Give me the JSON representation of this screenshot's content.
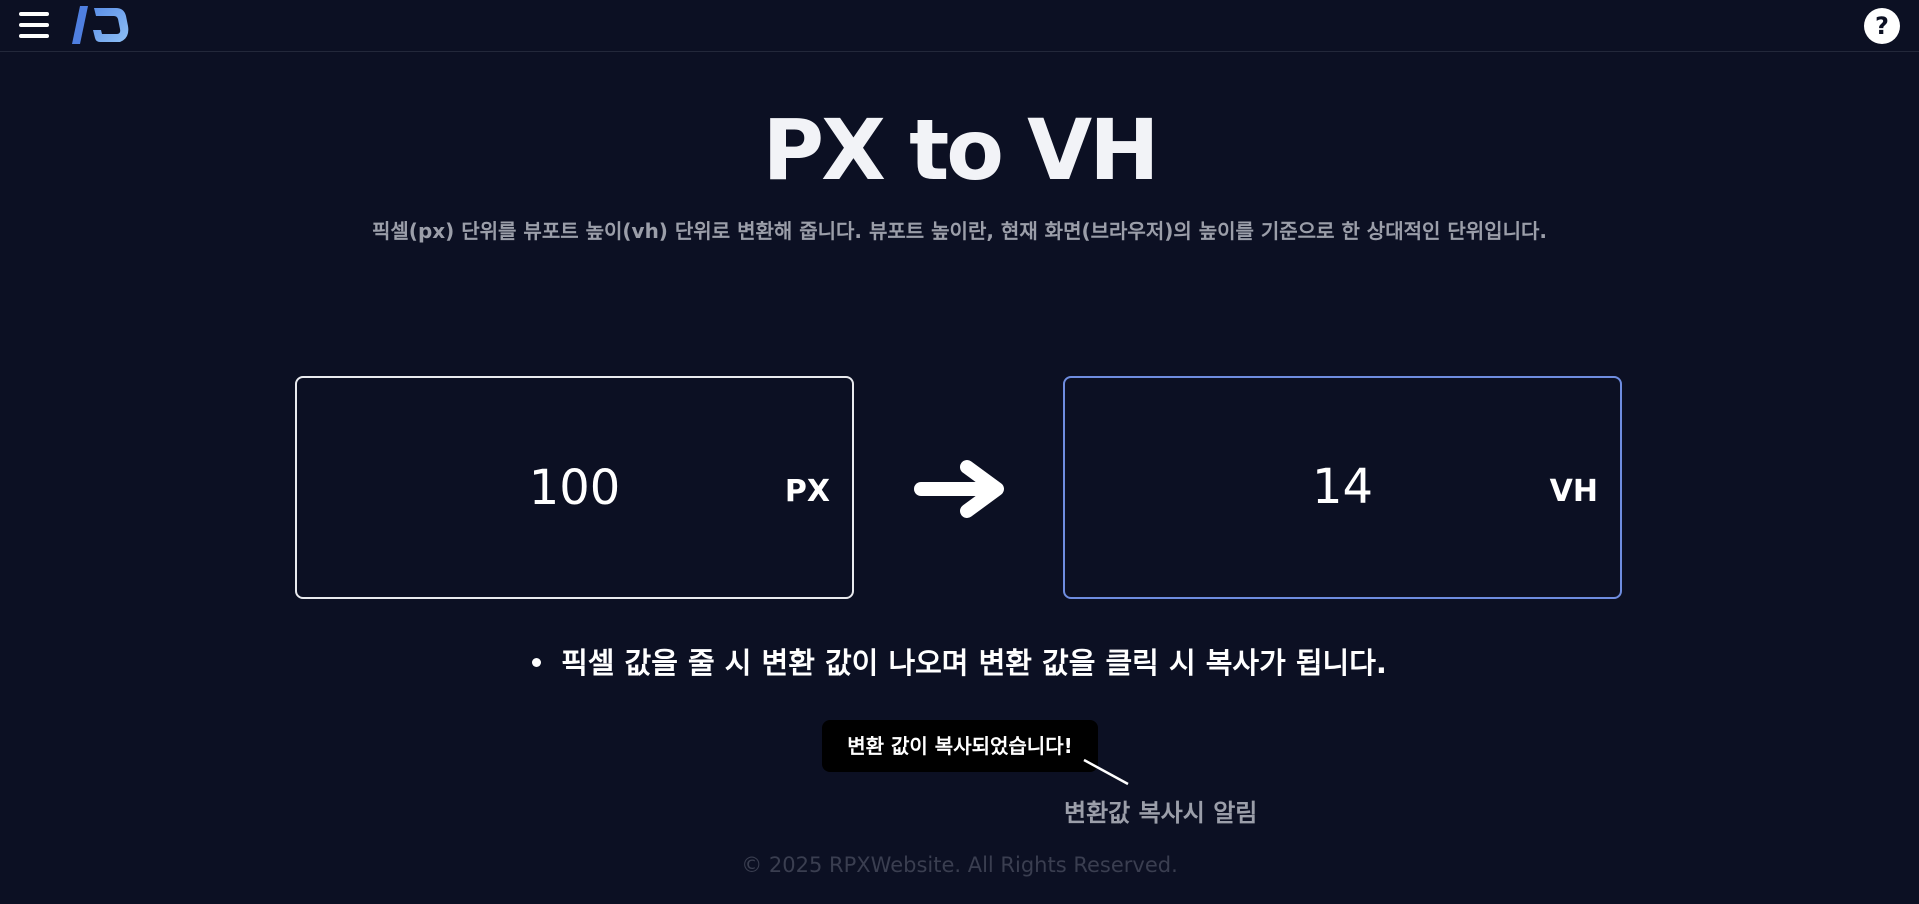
{
  "header": {
    "menu_icon": "hamburger-menu-icon",
    "logo_icon": "rpx-logo-icon",
    "help_label": "?"
  },
  "main": {
    "title": "PX to VH",
    "subtitle": "픽셀(px) 단위를 뷰포트 높이(vh) 단위로 변환해 줍니다. 뷰포트 높이란, 현재 화면(브라우저)의 높이를 기준으로 한 상대적인 단위입니다.",
    "px_input": {
      "value": "100",
      "unit": "PX"
    },
    "arrow_icon": "arrow-right-icon",
    "vh_output": {
      "value": "14",
      "unit": "VH"
    },
    "instruction": "픽셀 값을 줄 시 변환 값이 나오며 변환 값을 클릭 시 복사가 됩니다.",
    "toast": "변환 값이 복사되었습니다!",
    "toast_caption": "변환값 복사시 알림"
  },
  "footer": {
    "copyright": "© 2025 RPXWebsite. All Rights Reserved."
  },
  "colors": {
    "background": "#0c1023",
    "input_border": "#e9eaee",
    "output_border": "#6f8de0",
    "muted_text": "#9b9ea9",
    "toast_bg": "#000000"
  }
}
